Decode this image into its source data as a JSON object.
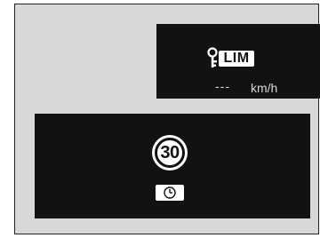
{
  "limiter_panel": {
    "icon": "speed-limiter-key-icon",
    "badge_label": "LIM",
    "speed_value": "---",
    "speed_unit": "km/h"
  },
  "sign_panel": {
    "speed_limit_value": "30",
    "timer_icon": "clock-icon"
  },
  "colors": {
    "background": "#d8d8d8",
    "panel": "#121212",
    "foreground": "#ffffff",
    "muted_text": "#d8d8d8"
  }
}
